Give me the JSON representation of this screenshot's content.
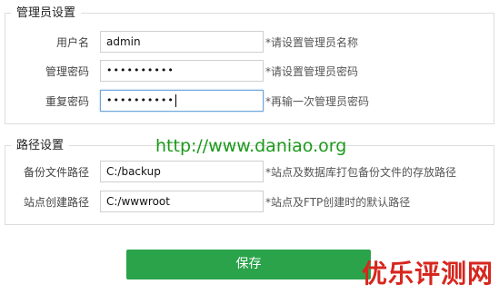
{
  "admin_section": {
    "legend": "管理员设置",
    "fields": [
      {
        "label": "用户名",
        "value": "admin",
        "hint": "*请设置管理员名称"
      },
      {
        "label": "管理密码",
        "value": "••••••••••",
        "hint": "*请设置管理员密码"
      },
      {
        "label": "重复密码",
        "value": "••••••••••",
        "hint": "*再输一次管理员密码"
      }
    ]
  },
  "path_section": {
    "legend": "路径设置",
    "fields": [
      {
        "label": "备份文件路径",
        "value": "C:/backup",
        "hint": "*站点及数据库打包备份文件的存放路径"
      },
      {
        "label": "站点创建路径",
        "value": "C:/wwwroot",
        "hint": "*站点及FTP创建时的默认路径"
      }
    ]
  },
  "save_button": {
    "label": "保存"
  },
  "watermark": {
    "text": "http://www.daniao.org"
  },
  "brand": {
    "text": "优乐评测网"
  },
  "colors": {
    "save_button": "#2aa34a",
    "brand": "#d7261e",
    "watermark": "#1a9a1a",
    "focus_border": "#6ea6d8"
  }
}
